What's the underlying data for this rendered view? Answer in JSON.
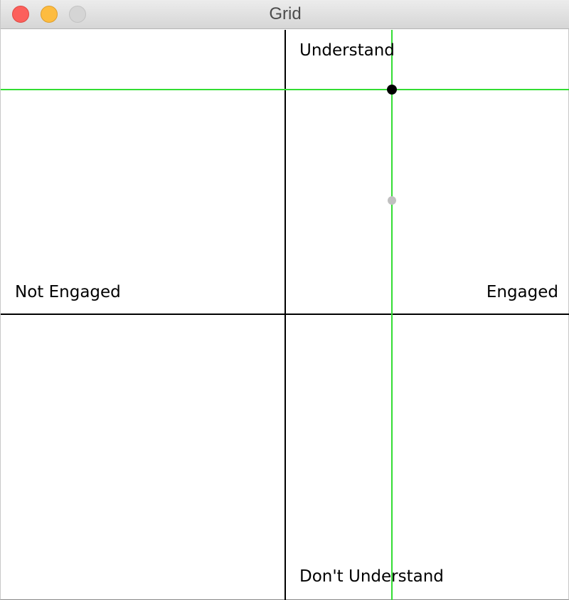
{
  "window": {
    "title": "Grid",
    "controls": {
      "close": "close",
      "minimize": "minimize",
      "zoom": "zoom"
    }
  },
  "grid": {
    "labels": {
      "top": "Understand",
      "bottom": "Don't Understand",
      "left": "Not Engaged",
      "right": "Engaged"
    },
    "colors": {
      "axis": "#000000",
      "crosshair": "#33dd33",
      "current_point": "#000000",
      "previous_point": "#c0c0c0"
    },
    "current_point": {
      "engagement": 0.375,
      "understanding": 0.79
    },
    "previous_point": {
      "engagement": 0.375,
      "understanding": 0.4
    }
  }
}
